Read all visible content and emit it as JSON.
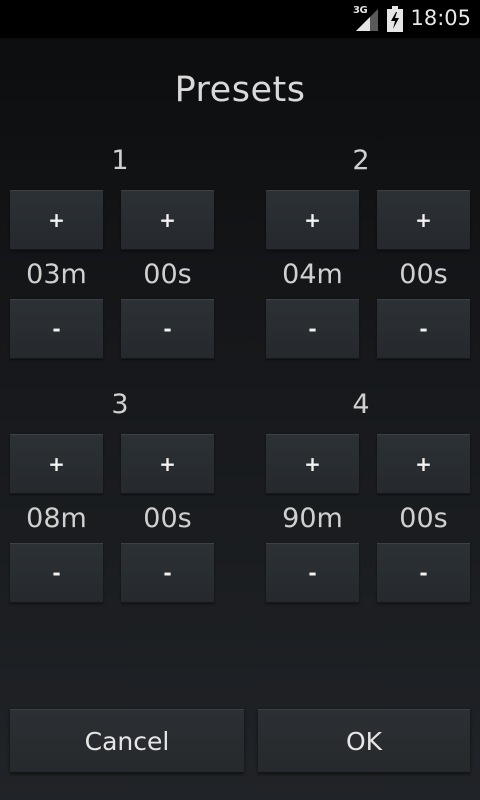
{
  "status_bar": {
    "network": "3G",
    "time": "18:05"
  },
  "dialog": {
    "title": "Presets"
  },
  "presets": [
    {
      "number": "1",
      "plus_label": "+",
      "minus_label": "-",
      "minutes": "03m",
      "seconds": "00s"
    },
    {
      "number": "2",
      "plus_label": "+",
      "minus_label": "-",
      "minutes": "04m",
      "seconds": "00s"
    },
    {
      "number": "3",
      "plus_label": "+",
      "minus_label": "-",
      "minutes": "08m",
      "seconds": "00s"
    },
    {
      "number": "4",
      "plus_label": "+",
      "minus_label": "-",
      "minutes": "90m",
      "seconds": "00s"
    }
  ],
  "actions": {
    "cancel_label": "Cancel",
    "ok_label": "OK"
  }
}
